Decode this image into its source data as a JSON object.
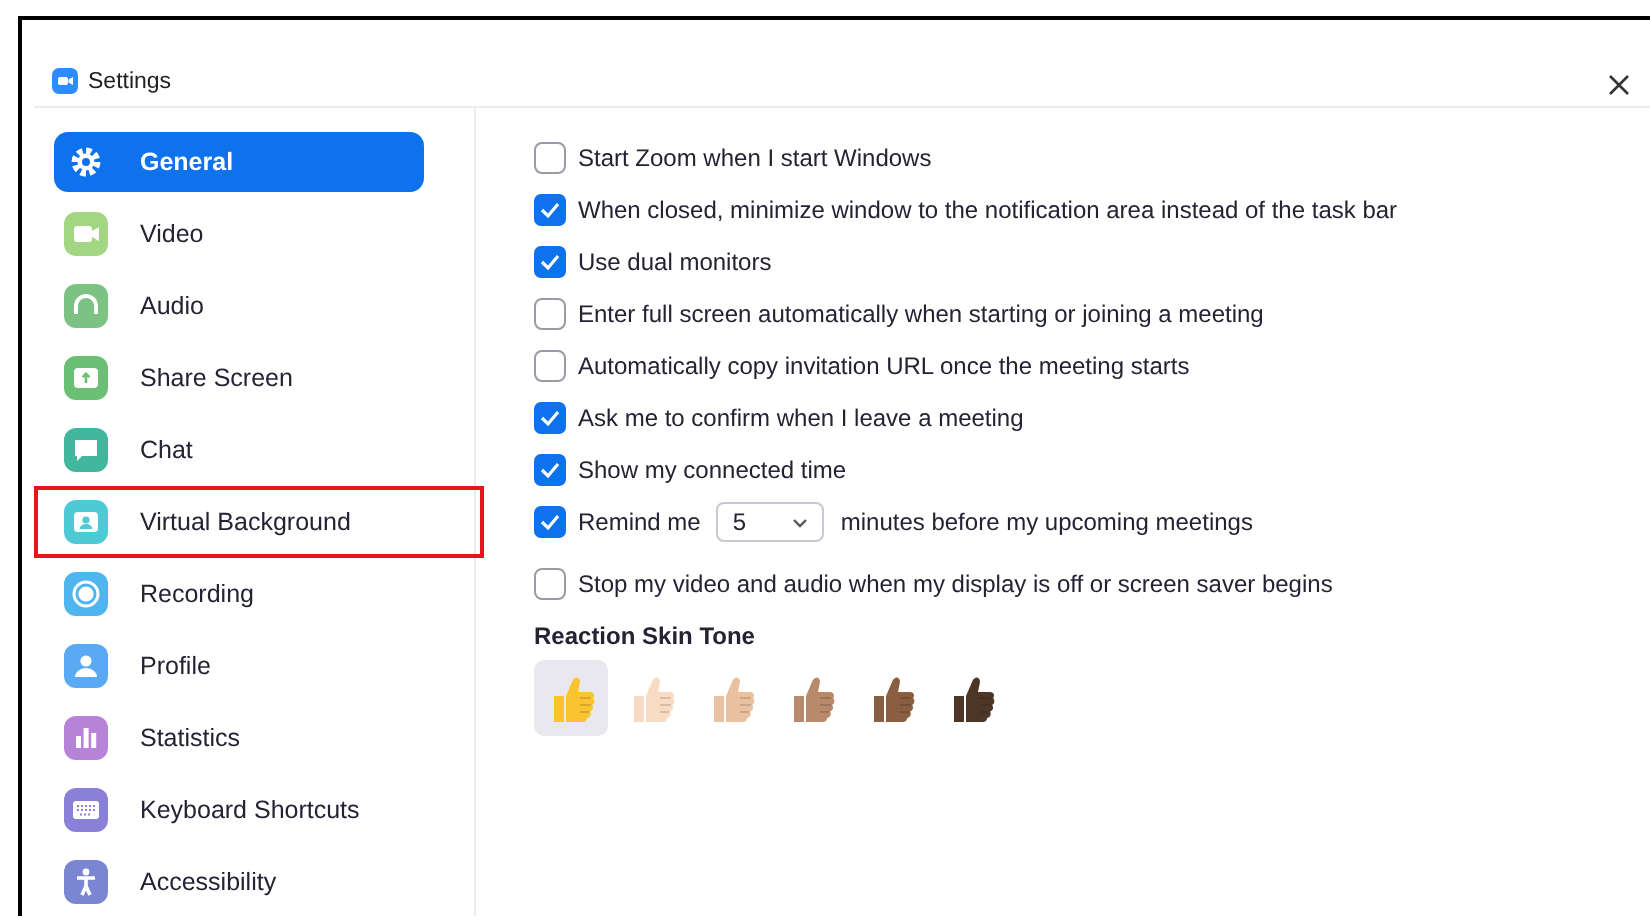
{
  "window": {
    "title": "Settings"
  },
  "sidebar": {
    "items": [
      {
        "label": "General",
        "selected": true,
        "highlighted": false,
        "color": "#ffffff"
      },
      {
        "label": "Video",
        "selected": false,
        "highlighted": false,
        "color": "#a3d682"
      },
      {
        "label": "Audio",
        "selected": false,
        "highlighted": false,
        "color": "#7cc383"
      },
      {
        "label": "Share Screen",
        "selected": false,
        "highlighted": false,
        "color": "#6bc076"
      },
      {
        "label": "Chat",
        "selected": false,
        "highlighted": false,
        "color": "#43b69e"
      },
      {
        "label": "Virtual Background",
        "selected": false,
        "highlighted": true,
        "color": "#4ec9d6"
      },
      {
        "label": "Recording",
        "selected": false,
        "highlighted": false,
        "color": "#4fb5ee"
      },
      {
        "label": "Profile",
        "selected": false,
        "highlighted": false,
        "color": "#5aa9f5"
      },
      {
        "label": "Statistics",
        "selected": false,
        "highlighted": false,
        "color": "#b783d8"
      },
      {
        "label": "Keyboard Shortcuts",
        "selected": false,
        "highlighted": false,
        "color": "#8b80d8"
      },
      {
        "label": "Accessibility",
        "selected": false,
        "highlighted": false,
        "color": "#7b86d2"
      }
    ]
  },
  "options": [
    {
      "kind": "checkbox",
      "label": "Start Zoom when I start Windows",
      "checked": false
    },
    {
      "kind": "checkbox",
      "label": "When closed, minimize window to the notification area instead of the task bar",
      "checked": true
    },
    {
      "kind": "checkbox",
      "label": "Use dual monitors",
      "checked": true
    },
    {
      "kind": "checkbox",
      "label": "Enter full screen automatically when starting or joining a meeting",
      "checked": false
    },
    {
      "kind": "checkbox",
      "label": "Automatically copy invitation URL once the meeting starts",
      "checked": false
    },
    {
      "kind": "checkbox",
      "label": "Ask me to confirm when I leave a meeting",
      "checked": true
    },
    {
      "kind": "checkbox",
      "label": "Show my connected time",
      "checked": true
    },
    {
      "kind": "reminder",
      "label": "Remind me",
      "value": "5",
      "suffix": "minutes before my upcoming meetings",
      "checked": true
    },
    {
      "kind": "checkbox",
      "label": "Stop my video and audio when my display is off or screen saver begins",
      "checked": false
    }
  ],
  "skin_tone": {
    "title": "Reaction Skin Tone",
    "tones": [
      {
        "color": "#f9c332",
        "selected": true
      },
      {
        "color": "#f7dcc3",
        "selected": false
      },
      {
        "color": "#e9c0a0",
        "selected": false
      },
      {
        "color": "#b8896a",
        "selected": false
      },
      {
        "color": "#8a5e40",
        "selected": false
      },
      {
        "color": "#4e3627",
        "selected": false
      }
    ]
  }
}
